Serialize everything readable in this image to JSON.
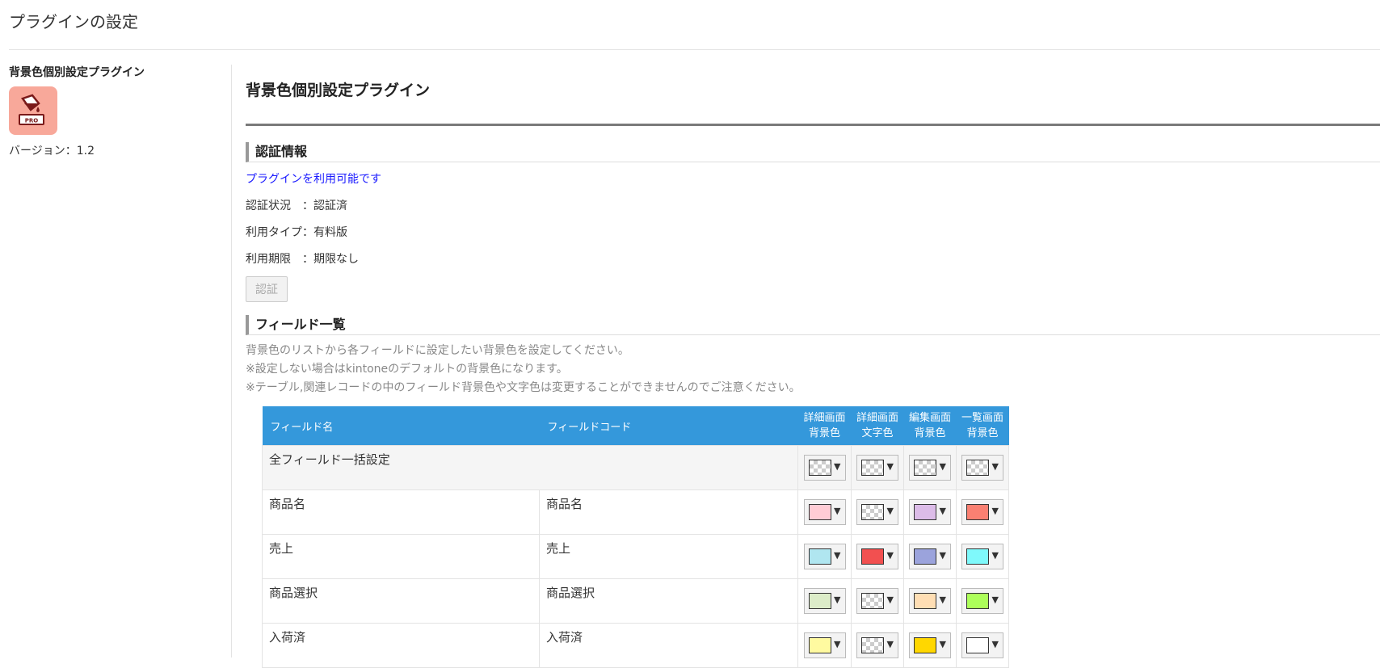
{
  "header": {
    "title": "プラグインの設定"
  },
  "sidebar": {
    "plugin_name": "背景色個別設定プラグイン",
    "version": "バージョン：1.2",
    "icon_badge": "PRO"
  },
  "main": {
    "title": "背景色個別設定プラグイン",
    "auth_section": {
      "heading": "認証情報",
      "available": "プラグインを利用可能です",
      "lines": [
        "認証状況　：認証済",
        "利用タイプ：有料版",
        "利用期限　：期限なし"
      ],
      "button": "認証"
    },
    "fields_section": {
      "heading": "フィールド一覧",
      "notes": [
        "背景色のリストから各フィールドに設定したい背景色を設定してください。",
        "※設定しない場合はkintoneのデフォルトの背景色になります。",
        "※テーブル,関連レコードの中のフィールド背景色や文字色は変更することができませんのでご注意ください。"
      ],
      "columns": {
        "field_name": "フィールド名",
        "field_code": "フィールドコード",
        "detail_bg": [
          "詳細画面",
          "背景色"
        ],
        "detail_text": [
          "詳細画面",
          "文字色"
        ],
        "edit_bg": [
          "編集画面",
          "背景色"
        ],
        "list_bg": [
          "一覧画面",
          "背景色"
        ]
      },
      "rows": [
        {
          "name": "全フィールド一括設定",
          "code": "",
          "colors": [
            "none",
            "none",
            "none",
            "none"
          ]
        },
        {
          "name": "商品名",
          "code": "商品名",
          "colors": [
            "#ffccd5",
            "none",
            "#dcbce8",
            "#fa8072"
          ]
        },
        {
          "name": "売上",
          "code": "売上",
          "colors": [
            "#b0e6f0",
            "#f25050",
            "#9ba3dc",
            "#7ff9fb"
          ]
        },
        {
          "name": "商品選択",
          "code": "商品選択",
          "colors": [
            "#dcecc8",
            "none",
            "#ffdeb4",
            "#adff5a"
          ]
        },
        {
          "name": "入荷済",
          "code": "入荷済",
          "colors": [
            "#fffaa0",
            "none",
            "#ffd700",
            "#ffffff"
          ]
        }
      ]
    }
  }
}
